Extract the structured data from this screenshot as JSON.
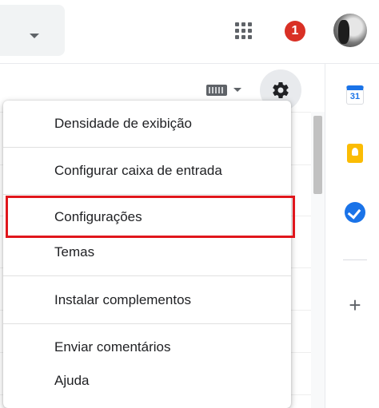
{
  "topbar": {
    "notification_count": "1",
    "icons": [
      "chevron-down-icon",
      "apps-grid-icon",
      "notification-badge",
      "avatar"
    ]
  },
  "toolbar": {
    "icons": [
      "keyboard-icon",
      "chevron-down-icon",
      "gear-icon"
    ]
  },
  "side_panel": {
    "calendar_day": "31",
    "icons": [
      "calendar-icon",
      "keep-icon",
      "tasks-icon",
      "plus-icon"
    ]
  },
  "settings_menu": {
    "items": [
      "Densidade de exibição",
      "Configurar caixa de entrada",
      "Configurações",
      "Temas",
      "Instalar complementos",
      "Enviar comentários",
      "Ajuda"
    ],
    "highlighted_item": "Configurações"
  },
  "colors": {
    "highlight_border": "#e0161c",
    "badge": "#d93025",
    "accent": "#1a73e8"
  }
}
